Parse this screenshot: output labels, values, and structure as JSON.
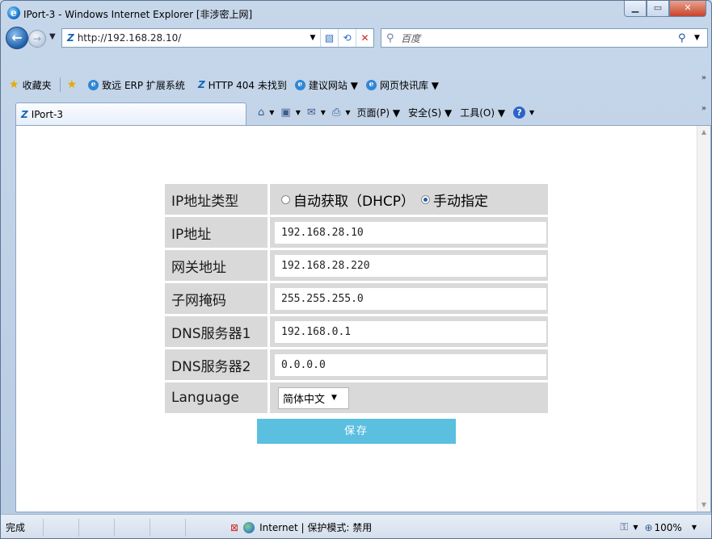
{
  "window": {
    "title": "IPort-3 - Windows Internet Explorer [非涉密上网]",
    "buttons": {
      "minimize": "▁",
      "maximize": "▭",
      "close": "✕"
    }
  },
  "address_bar": {
    "url": "http://192.168.28.10/",
    "search_placeholder": "百度"
  },
  "favorites_bar": {
    "favorites_label": "收藏夹",
    "items": [
      {
        "label": "致远 ERP 扩展系统",
        "icon": "ie-icon"
      },
      {
        "label": "HTTP 404 未找到",
        "icon": "zs-icon"
      },
      {
        "label": "建议网站 ▼",
        "icon": "ie-icon"
      },
      {
        "label": "网页快讯库 ▼",
        "icon": "ie-icon"
      }
    ]
  },
  "tab": {
    "label": "IPort-3"
  },
  "command_bar": {
    "page": "页面(P)",
    "safety": "安全(S)",
    "tools": "工具(O)"
  },
  "form": {
    "rows": [
      {
        "label": "IP地址类型",
        "kind": "radio",
        "options": [
          "自动获取（DHCP）",
          "手动指定"
        ],
        "selected": "手动指定"
      },
      {
        "label": "IP地址",
        "kind": "input",
        "value": "192.168.28.10"
      },
      {
        "label": "网关地址",
        "kind": "input",
        "value": "192.168.28.220"
      },
      {
        "label": "子网掩码",
        "kind": "input",
        "value": "255.255.255.0"
      },
      {
        "label": "DNS服务器1",
        "kind": "input",
        "value": "192.168.0.1"
      },
      {
        "label": "DNS服务器2",
        "kind": "input",
        "value": "0.0.0.0"
      },
      {
        "label": "Language",
        "kind": "select",
        "value": "简体中文"
      }
    ],
    "save_label": "保存"
  },
  "status_bar": {
    "status": "完成",
    "zone": "Internet | 保护模式: 禁用",
    "zoom": "100%"
  },
  "colors": {
    "save_button": "#5bbfe0",
    "label_bg": "#d9d9d9",
    "radio_checked": "#1d5fb0"
  }
}
